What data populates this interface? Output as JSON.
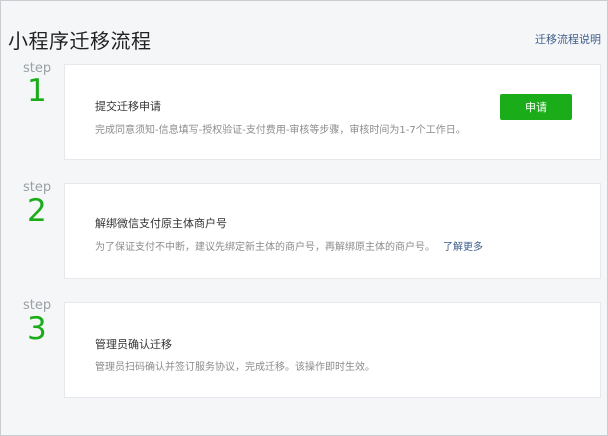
{
  "header": {
    "title": "小程序迁移流程",
    "help_link": "迁移流程说明"
  },
  "steps": [
    {
      "label": "step",
      "number": "1",
      "title": "提交迁移申请",
      "description": "完成同意须知-信息填写-授权验证-支付费用-审核等步骤，审核时间为1-7个工作日。",
      "button": "申请"
    },
    {
      "label": "step",
      "number": "2",
      "title": "解绑微信支付原主体商户号",
      "description": "为了保证支付不中断，建议先绑定新主体的商户号，再解绑原主体的商户号。",
      "link": "了解更多"
    },
    {
      "label": "step",
      "number": "3",
      "title": "管理员确认迁移",
      "description": "管理员扫码确认并签订服务协议，完成迁移。该操作即时生效。"
    }
  ],
  "colors": {
    "accent": "#1aad19",
    "link": "#3e5d8c"
  }
}
